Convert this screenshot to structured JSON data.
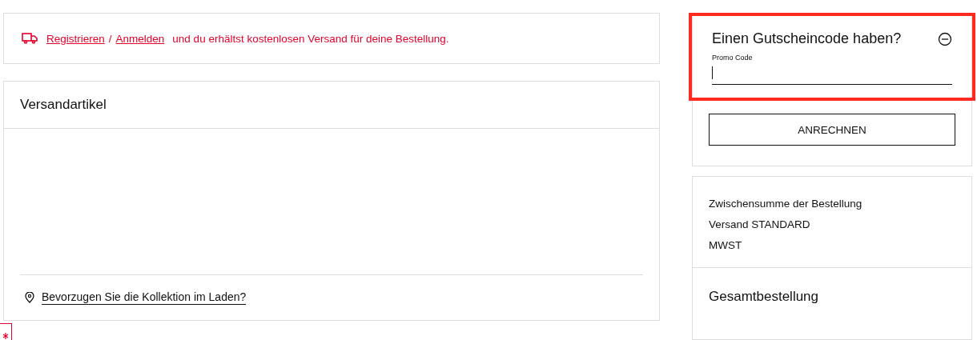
{
  "banner": {
    "links": [
      "Registrieren",
      "Anmelden"
    ],
    "separator": "/",
    "message": "und du erhältst kostenlosen Versand für deine Bestellung."
  },
  "shipping_card": {
    "title": "Versandartikel",
    "store_pickup_link": "Bevorzugen Sie die Kollektion im Laden?"
  },
  "promo": {
    "title": "Einen Gutscheincode haben?",
    "expanded": true,
    "highlighted": true,
    "field_label": "Promo Code",
    "button": "ANRECHNEN"
  },
  "summary": {
    "lines": [
      "Zwischensumme der Bestellung",
      "Versand STANDARD",
      "MWST"
    ],
    "total_label": "Gesamtbestellung"
  }
}
